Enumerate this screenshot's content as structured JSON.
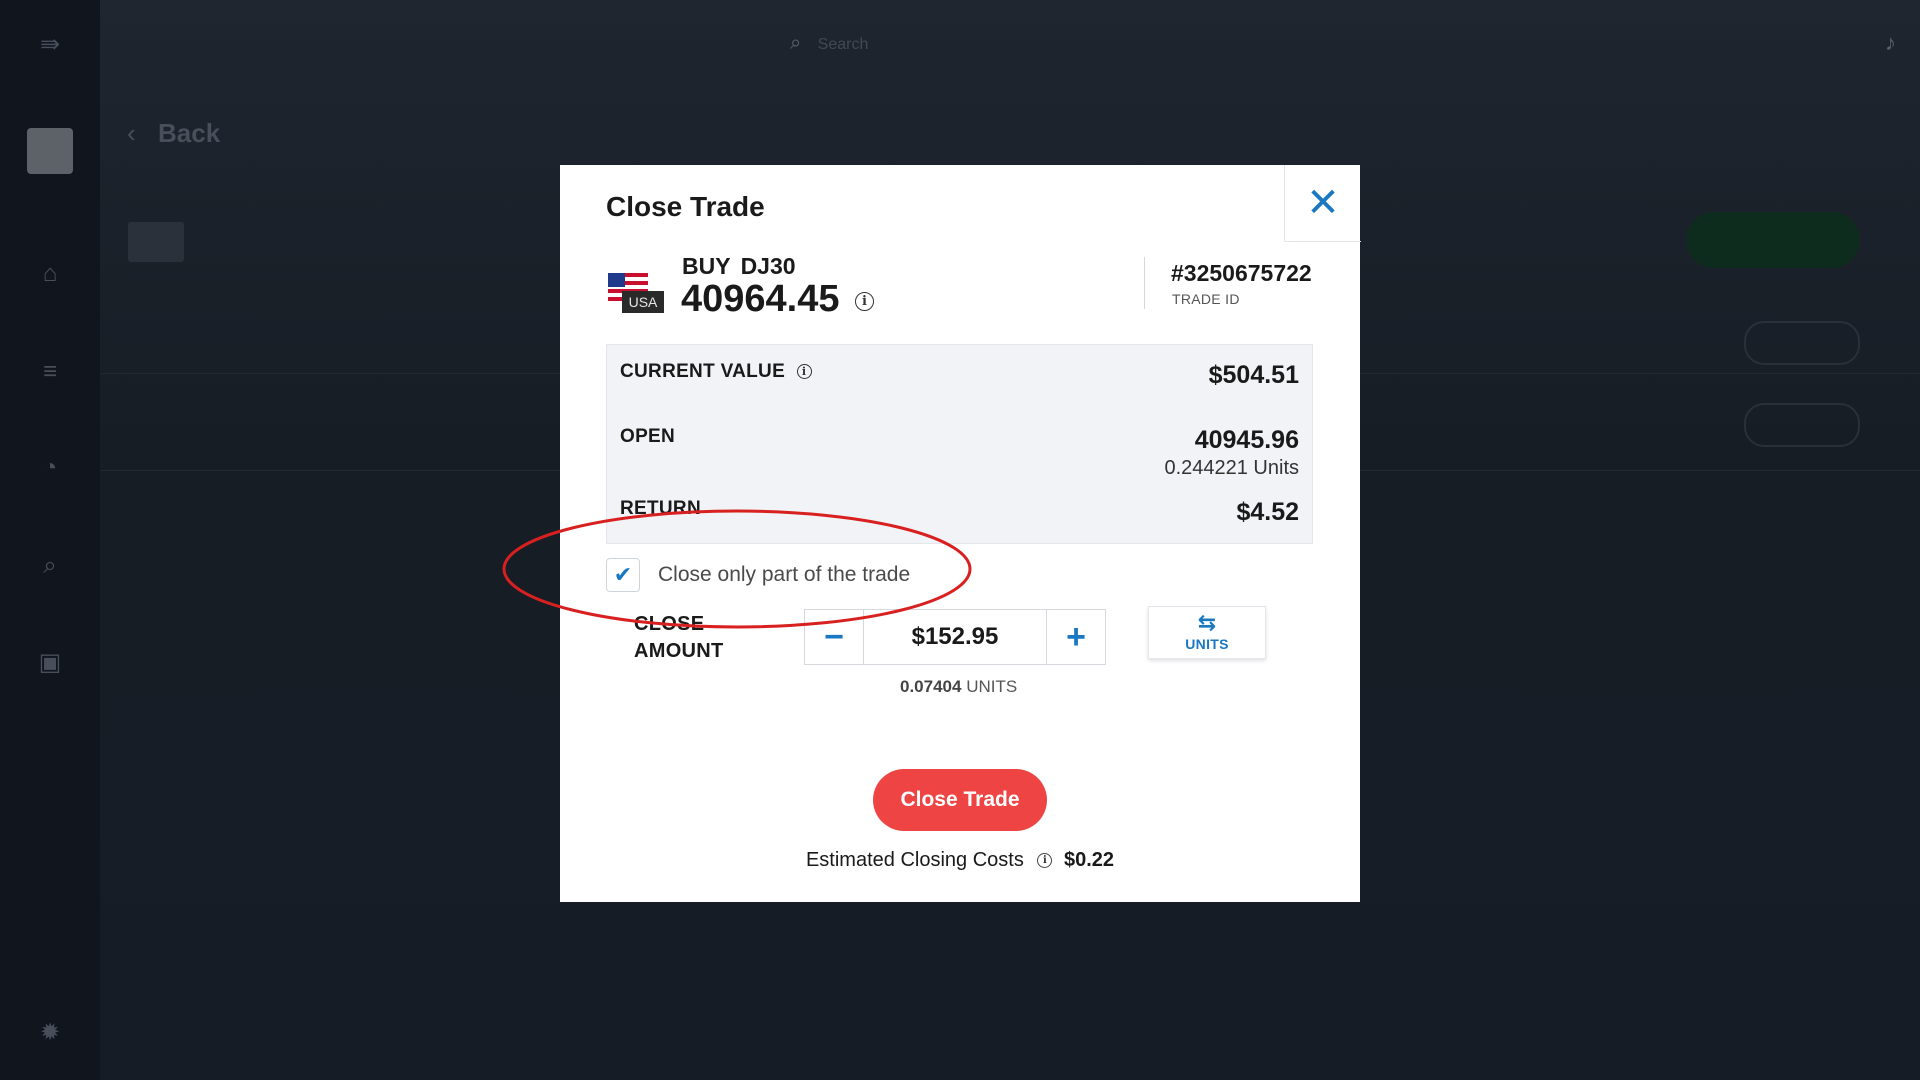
{
  "background": {
    "back_label": "Back",
    "search_placeholder": "Search"
  },
  "modal": {
    "title": "Close Trade",
    "side": "BUY",
    "symbol": "DJ30",
    "price": "40964.45",
    "flag_label": "USA",
    "trade_id": "#3250675722",
    "trade_id_label": "TRADE ID",
    "summary": {
      "current_value_label": "CURRENT VALUE",
      "current_value": "$504.51",
      "open_label": "OPEN",
      "open_value": "40945.96",
      "open_units": "0.244221 Units",
      "return_label": "RETURN",
      "return_value": "$4.52"
    },
    "partial_close": {
      "label": "Close only part of the trade",
      "checked": true
    },
    "close_amount": {
      "label": "CLOSE AMOUNT",
      "value": "$152.95",
      "units_value": "0.07404",
      "units_label": "UNITS",
      "toggle_label": "UNITS"
    },
    "close_button_label": "Close Trade",
    "estimated_costs_label": "Estimated Closing Costs",
    "estimated_costs_value": "$0.22"
  },
  "colors": {
    "accent": "#1a78c2",
    "close_button": "#ef4444",
    "annotation": "#d92020"
  },
  "icons": {
    "close": "close-icon",
    "info": "info-icon",
    "check": "check-icon",
    "minus": "minus-icon",
    "plus": "plus-icon",
    "swap": "swap-icon"
  }
}
